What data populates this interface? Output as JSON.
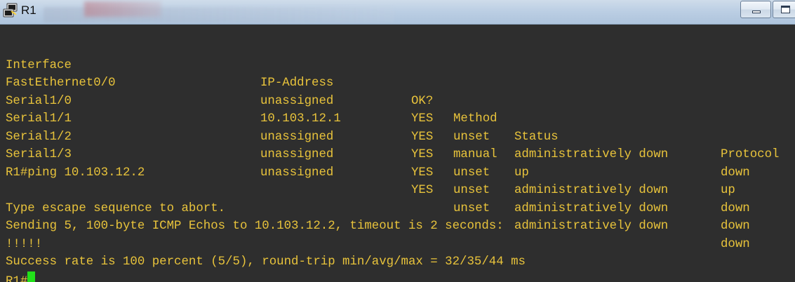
{
  "window": {
    "title": "R1",
    "icon": "putty-terminal-icon",
    "controls": [
      "minimize-icon",
      "maximize-icon"
    ]
  },
  "colors": {
    "terminal_bg": "#2e2e2e",
    "terminal_fg": "#e8c33b",
    "cursor": "#22e11a",
    "titlebar": "#bccfe4"
  },
  "terminal": {
    "header": {
      "interface": "Interface",
      "ip": "IP-Address",
      "ok": "OK?",
      "method": "Method",
      "status": "Status",
      "protocol": "Protocol"
    },
    "rows": [
      {
        "interface": "FastEthernet0/0",
        "ip": "unassigned",
        "ok": "YES",
        "method": "unset",
        "status": "administratively down",
        "protocol": "down"
      },
      {
        "interface": "Serial1/0",
        "ip": "10.103.12.1",
        "ok": "YES",
        "method": "manual",
        "status": "up",
        "protocol": "up"
      },
      {
        "interface": "Serial1/1",
        "ip": "unassigned",
        "ok": "YES",
        "method": "unset",
        "status": "administratively down",
        "protocol": "down"
      },
      {
        "interface": "Serial1/2",
        "ip": "unassigned",
        "ok": "YES",
        "method": "unset",
        "status": "administratively down",
        "protocol": "down"
      },
      {
        "interface": "Serial1/3",
        "ip": "unassigned",
        "ok": "YES",
        "method": "unset",
        "status": "administratively down",
        "protocol": "down"
      }
    ],
    "ping_command": "R1#ping 10.103.12.2",
    "blank": "",
    "escape_msg": "Type escape sequence to abort.",
    "sending_msg": "Sending 5, 100-byte ICMP Echos to 10.103.12.2, timeout is 2 seconds:",
    "ping_result": "!!!!!",
    "success_msg": "Success rate is 100 percent (5/5), round-trip min/avg/max = 32/35/44 ms",
    "prompt": "R1#"
  }
}
